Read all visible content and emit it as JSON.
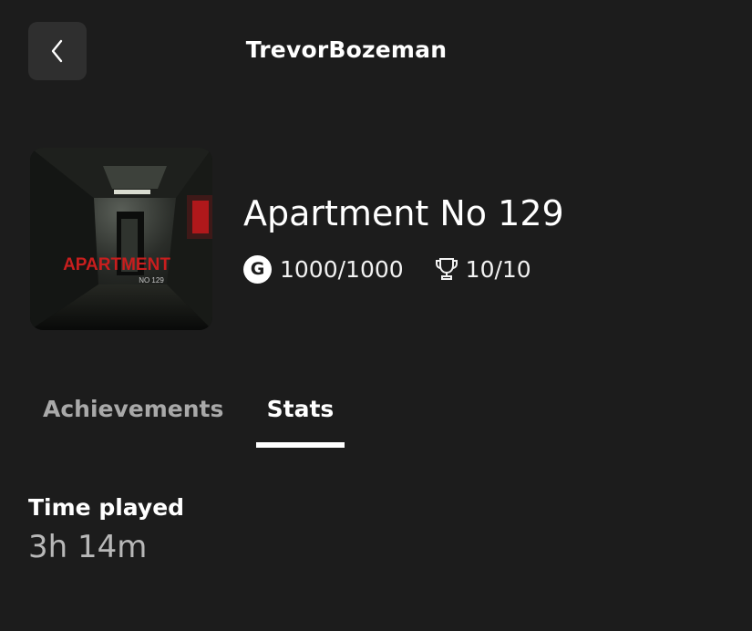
{
  "header": {
    "title": "TrevorBozeman"
  },
  "game": {
    "title": "Apartment No 129",
    "cover_text": "APARTMENT",
    "cover_subtext": "NO 129",
    "gamerscore": "1000/1000",
    "achievements_count": "10/10",
    "icons": {
      "back": "chevron-left-icon",
      "gamerscore": "gamerscore-icon",
      "trophy": "trophy-icon"
    }
  },
  "tabs": [
    {
      "label": "Achievements",
      "active": false
    },
    {
      "label": "Stats",
      "active": true
    }
  ],
  "stats": {
    "time_played_label": "Time played",
    "time_played_value": "3h 14m"
  },
  "colors": {
    "background": "#1c1c1c",
    "button_bg": "#2f2f2f",
    "inactive_tab": "#a9a9a9",
    "cover_title_red": "#c81e1e"
  }
}
